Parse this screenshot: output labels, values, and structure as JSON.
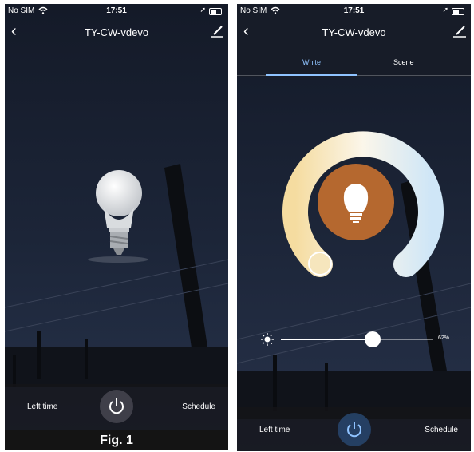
{
  "phone1": {
    "status": {
      "carrier": "No SIM",
      "time": "17:51"
    },
    "nav": {
      "title": "TY-CW-vdevo"
    },
    "bottom": {
      "left_time": "Left time",
      "schedule": "Schedule"
    }
  },
  "phone2": {
    "status": {
      "carrier": "No SIM",
      "time": "17:51"
    },
    "nav": {
      "title": "TY-CW-vdevo"
    },
    "tabs": [
      "White",
      "Scene"
    ],
    "brightness": {
      "value": 62,
      "label": "62%"
    },
    "bottom": {
      "left_time": "Left time",
      "schedule": "Schedule"
    }
  },
  "caption": "Fig. 1",
  "colors": {
    "accent": "#8fc3ff",
    "bulb_circle": "#b5682f",
    "bg_dark": "#1b2234"
  },
  "icons": [
    "back-icon",
    "edit-icon",
    "wifi-icon",
    "location-icon",
    "battery-icon",
    "power-icon",
    "sun-icon",
    "bulb-icon"
  ]
}
